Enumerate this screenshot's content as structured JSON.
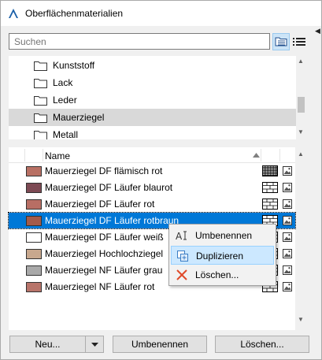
{
  "window": {
    "title": "Oberflächenmaterialien",
    "app_icon": "archicad-logo-icon"
  },
  "search": {
    "placeholder": "Suchen",
    "value": ""
  },
  "view_toggle": {
    "left_icon": "folder-tree-icon",
    "right_icon": "list-view-icon"
  },
  "tree": {
    "items": [
      {
        "label": "Kunststoff",
        "selected": false
      },
      {
        "label": "Lack",
        "selected": false
      },
      {
        "label": "Leder",
        "selected": false
      },
      {
        "label": "Mauerziegel",
        "selected": true
      },
      {
        "label": "Metall",
        "selected": false
      }
    ]
  },
  "list": {
    "column_name": "Name",
    "rows": [
      {
        "name": "Mauerziegel DF flämisch rot",
        "color": "#b87064",
        "pattern": "grid"
      },
      {
        "name": "Mauerziegel DF Läufer blaurot",
        "color": "#7d4a54",
        "pattern": "brick"
      },
      {
        "name": "Mauerziegel DF Läufer rot",
        "color": "#b86e64",
        "pattern": "brick"
      },
      {
        "name": "Mauerziegel DF Läufer rotbraun",
        "color": "#a45b4a",
        "pattern": "brick",
        "selected": true
      },
      {
        "name": "Mauerziegel DF Läufer weiß",
        "color": "#ffffff",
        "pattern": "brick"
      },
      {
        "name": "Mauerziegel Hochlochziegel",
        "color": "#c8a88e",
        "pattern": "brick"
      },
      {
        "name": "Mauerziegel NF Läufer grau",
        "color": "#a9a9a9",
        "pattern": "brick"
      },
      {
        "name": "Mauerziegel NF Läufer rot",
        "color": "#b8746a",
        "pattern": "brick"
      }
    ]
  },
  "context_menu": {
    "items": [
      {
        "label": "Umbenennen",
        "icon": "rename-icon"
      },
      {
        "label": "Duplizieren",
        "icon": "duplicate-icon",
        "hover": true
      },
      {
        "label": "Löschen...",
        "icon": "delete-icon"
      }
    ]
  },
  "buttons": {
    "new_label": "Neu...",
    "rename_label": "Umbenennen",
    "delete_label": "Löschen..."
  },
  "colors": {
    "selection": "#0078d7",
    "menu_hover": "#cce8ff",
    "delete_x": "#e04a2a"
  }
}
